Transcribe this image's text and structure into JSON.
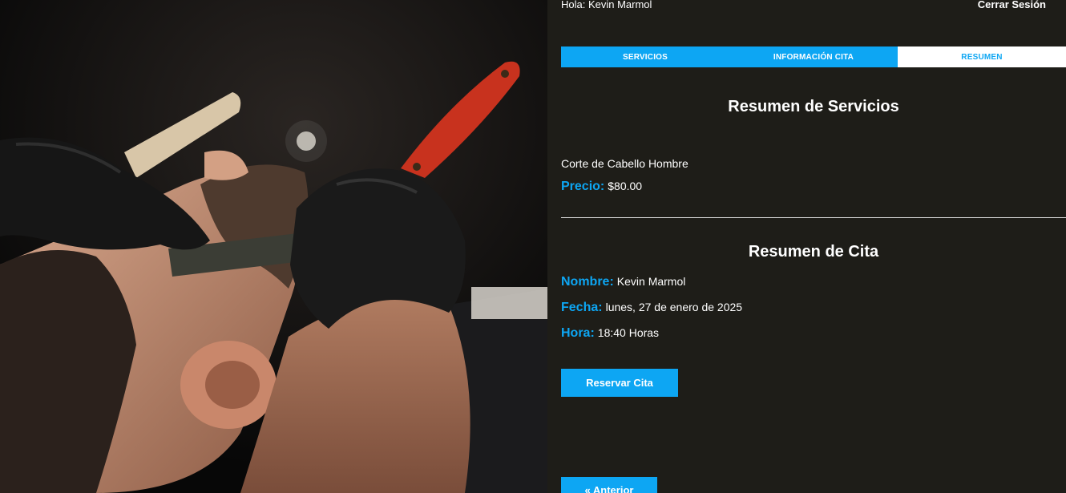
{
  "header": {
    "greeting": "Hola: Kevin Marmol",
    "logout_label": "Cerrar Sesión"
  },
  "tabs": [
    {
      "label": "Servicios",
      "active": false
    },
    {
      "label": "Información Cita",
      "active": false
    },
    {
      "label": "Resumen",
      "active": true
    }
  ],
  "services_summary": {
    "title": "Resumen de Servicios",
    "service_name": "Corte de Cabello Hombre",
    "price_label": "Precio:",
    "price_value": "$80.00"
  },
  "appointment_summary": {
    "title": "Resumen de Cita",
    "name_label": "Nombre:",
    "name_value": "Kevin Marmol",
    "date_label": "Fecha:",
    "date_value": "lunes, 27 de enero de 2025",
    "time_label": "Hora:",
    "time_value": "18:40 Horas"
  },
  "buttons": {
    "reserve_label": "Reservar Cita",
    "previous_label": "« Anterior"
  },
  "colors": {
    "accent": "#0da6f3",
    "background": "#1e1d18"
  },
  "icons": {
    "hero_image": "barber-shaving-photo"
  }
}
